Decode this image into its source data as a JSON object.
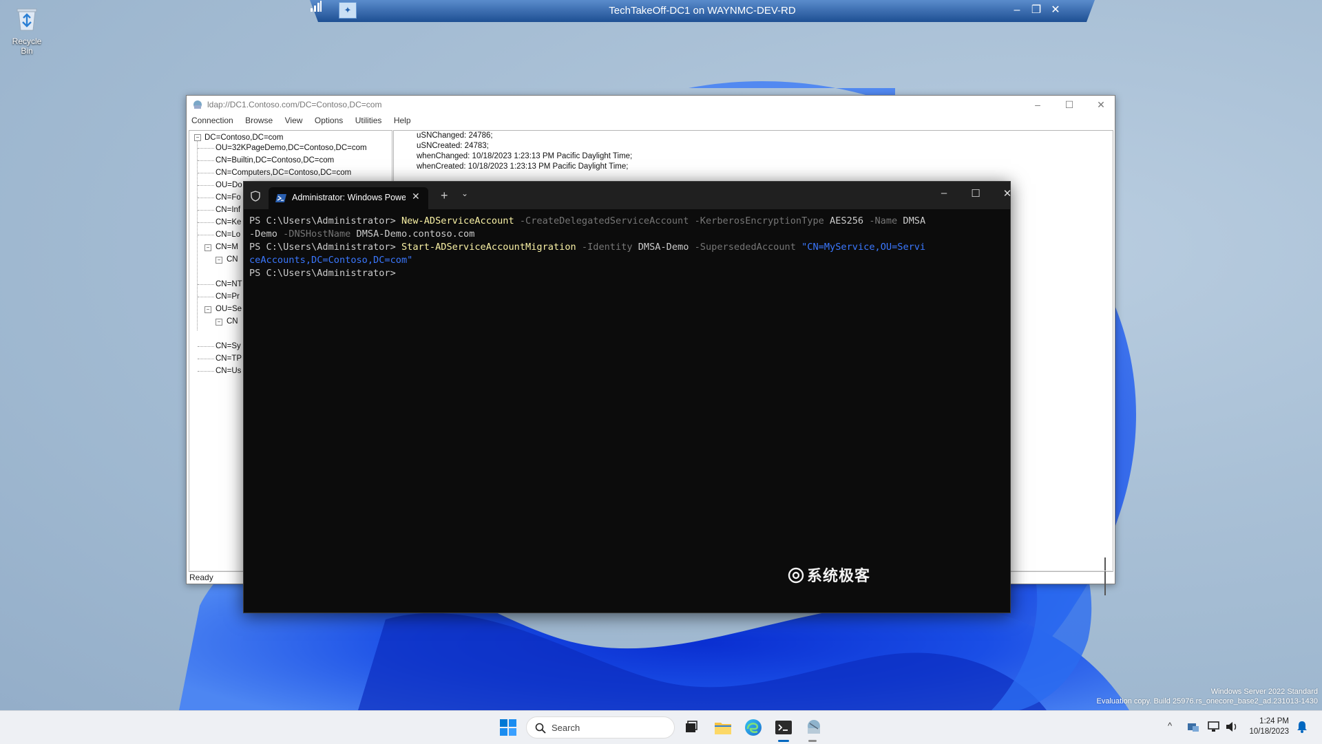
{
  "desktop": {
    "recycle_bin_label": "Recycle Bin",
    "eval_line1": "Windows Server 2022 Standard",
    "eval_line2": "Evaluation copy. Build 25976.rs_onecore_base2_ad.231013-1430"
  },
  "rdp_bar": {
    "title": "TechTakeOff-DC1 on WAYNMC-DEV-RD",
    "minimize": "–",
    "restore": "❐",
    "close": "✕"
  },
  "ldp": {
    "title": "ldap://DC1.Contoso.com/DC=Contoso,DC=com",
    "menu": [
      "Connection",
      "Browse",
      "View",
      "Options",
      "Utilities",
      "Help"
    ],
    "tree_root": "DC=Contoso,DC=com",
    "tree_items": [
      "OU=32KPageDemo,DC=Contoso,DC=com",
      "CN=Builtin,DC=Contoso,DC=com",
      "CN=Computers,DC=Contoso,DC=com",
      "OU=Do",
      "CN=Fo",
      "CN=Inf",
      "CN=Ke",
      "CN=Lo",
      "CN=M",
      "CN",
      "CN=NT",
      "CN=Pr",
      "OU=Se",
      "CN",
      "CN=Sy",
      "CN=TP",
      "CN=Us"
    ],
    "detail_lines": [
      "uSNChanged: 24786;",
      "uSNCreated: 24783;",
      "whenChanged: 10/18/2023 1:23:13 PM Pacific Daylight Time;",
      "whenCreated: 10/18/2023 1:23:13 PM Pacific Daylight Time;"
    ],
    "status": "Ready"
  },
  "terminal": {
    "tab_label": "Administrator: Windows PowerShell",
    "new_tab": "+",
    "dropdown": "⌄",
    "minimize": "–",
    "maximize": "☐",
    "close": "✕",
    "prompt": "PS C:\\Users\\Administrator>",
    "line1": {
      "cmd": "New-ADServiceAccount",
      "p1": "-CreateDelegatedServiceAccount",
      "p2": "-KerberosEncryptionType",
      "v2": "AES256",
      "p3": "-Name",
      "v3a": "DMSA",
      "v3b": "-Demo",
      "p4": "-DNSHostName",
      "v4": "DMSA-Demo.contoso.com"
    },
    "line2": {
      "cmd": "Start-ADServiceAccountMigration",
      "p1": "-Identity",
      "v1": "DMSA-Demo",
      "p2": "-SupersededAccount",
      "v2a": "\"CN=MyService,OU=Servi",
      "v2b": "ceAccounts,DC=Contoso,DC=com\""
    },
    "watermark": "系统极客"
  },
  "taskbar": {
    "search_placeholder": "Search",
    "time": "1:24 PM",
    "date": "10/18/2023",
    "chevron": "^"
  },
  "colors": {
    "accent": "#0067c0",
    "terminal_bg": "#0c0c0c",
    "cmd_yellow": "#f9f1a5",
    "param_gray": "#767676",
    "string_blue": "#3b78ff"
  }
}
